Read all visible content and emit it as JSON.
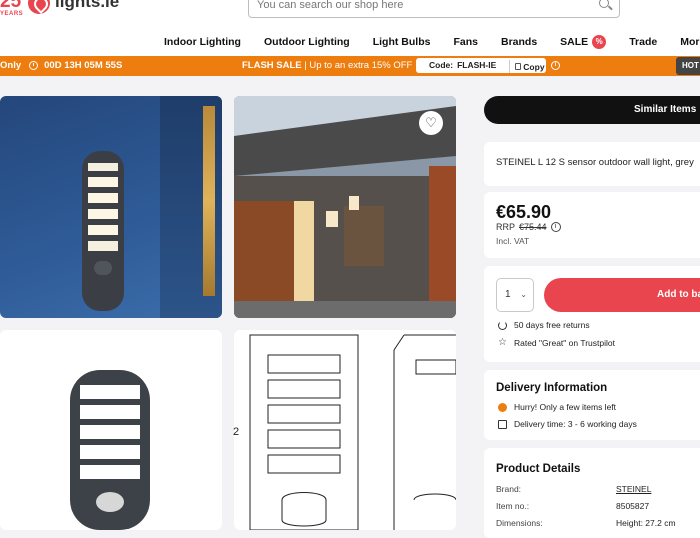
{
  "header": {
    "logo_years": "25",
    "logo_years_word": "YEARS",
    "logo_text": "lights.ie",
    "search_placeholder": "You can search our shop here",
    "nav": [
      "Indoor Lighting",
      "Outdoor Lighting",
      "Light Bulbs",
      "Fans",
      "Brands",
      "SALE",
      "Trade",
      "More"
    ],
    "sale_badge": "%"
  },
  "flash_bar": {
    "countdown_prefix": "Only",
    "countdown": "00D 13H 05M 55S",
    "headline": "FLASH SALE",
    "headline_detail": " | Up to an extra 15% OFF",
    "code_label": "Code:",
    "code": "FLASH-IE",
    "copy_label": "Copy",
    "info": "i",
    "hot_tab": "HOT"
  },
  "gallery": {
    "dimension_label": "2"
  },
  "product": {
    "similar_label": "Similar Items",
    "title": "STEINEL L 12 S sensor outdoor wall light, grey",
    "price": "€65.90",
    "rrp_label": "RRP",
    "rrp_value": "€75.44",
    "vat_note": "Incl. VAT",
    "quantity": "1",
    "add_to_basket": "Add to basket",
    "returns": "50 days free returns",
    "rating": "Rated \"Great\" on Trustpilot"
  },
  "delivery": {
    "title": "Delivery Information",
    "stock": "Hurry! Only a few items left",
    "time": "Delivery time: 3 - 6 working days"
  },
  "details": {
    "title": "Product Details",
    "rows": [
      {
        "label": "Brand:",
        "value": "STEINEL"
      },
      {
        "label": "Item no.:",
        "value": "8505827"
      },
      {
        "label": "Dimensions:",
        "value": "Height: 27.2 cm"
      }
    ]
  },
  "colors": {
    "brand_red": "#e8454f",
    "flash_orange": "#ee7d10"
  }
}
